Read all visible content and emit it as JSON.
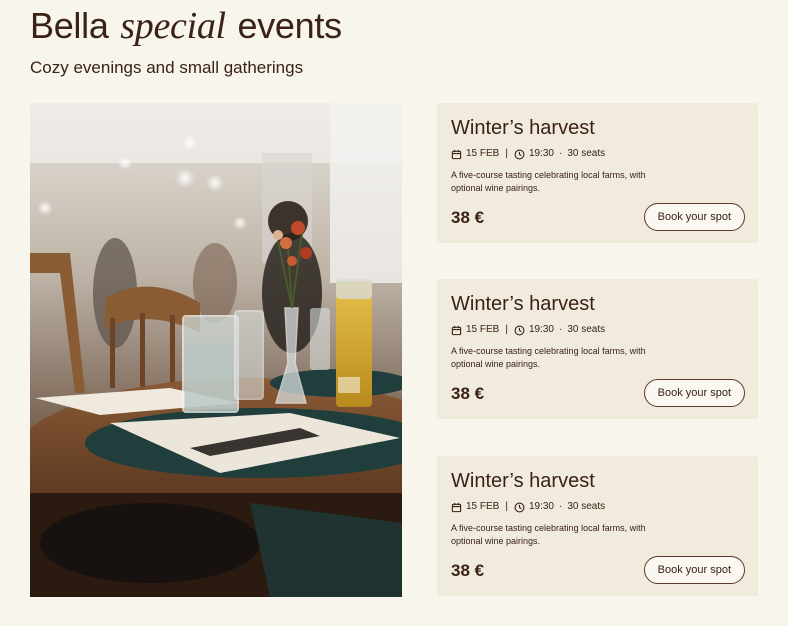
{
  "header": {
    "title_before": "Bella",
    "title_accent": "special",
    "title_after": "events",
    "subtitle": "Cozy evenings and small gatherings"
  },
  "colors": {
    "background": "#f8f5ec",
    "card_background": "#f1ebdd",
    "text": "#3a2218"
  },
  "events": [
    {
      "title": "Winter’s harvest",
      "date": "15 FEB",
      "time": "19:30",
      "seats": "30 seats",
      "description": "A five-course tasting celebrating local farms, with optional wine pairings.",
      "price": "38 €",
      "button_label": "Book your spot"
    },
    {
      "title": "Winter’s harvest",
      "date": "15 FEB",
      "time": "19:30",
      "seats": "30 seats",
      "description": "A five-course tasting celebrating local farms, with optional wine pairings.",
      "price": "38 €",
      "button_label": "Book your spot"
    },
    {
      "title": "Winter’s harvest",
      "date": "15 FEB",
      "time": "19:30",
      "seats": "30 seats",
      "description": "A five-course tasting celebrating local farms, with optional wine pairings.",
      "price": "38 €",
      "button_label": "Book your spot"
    }
  ],
  "icons": {
    "date": "calendar-icon",
    "time": "clock-icon"
  }
}
